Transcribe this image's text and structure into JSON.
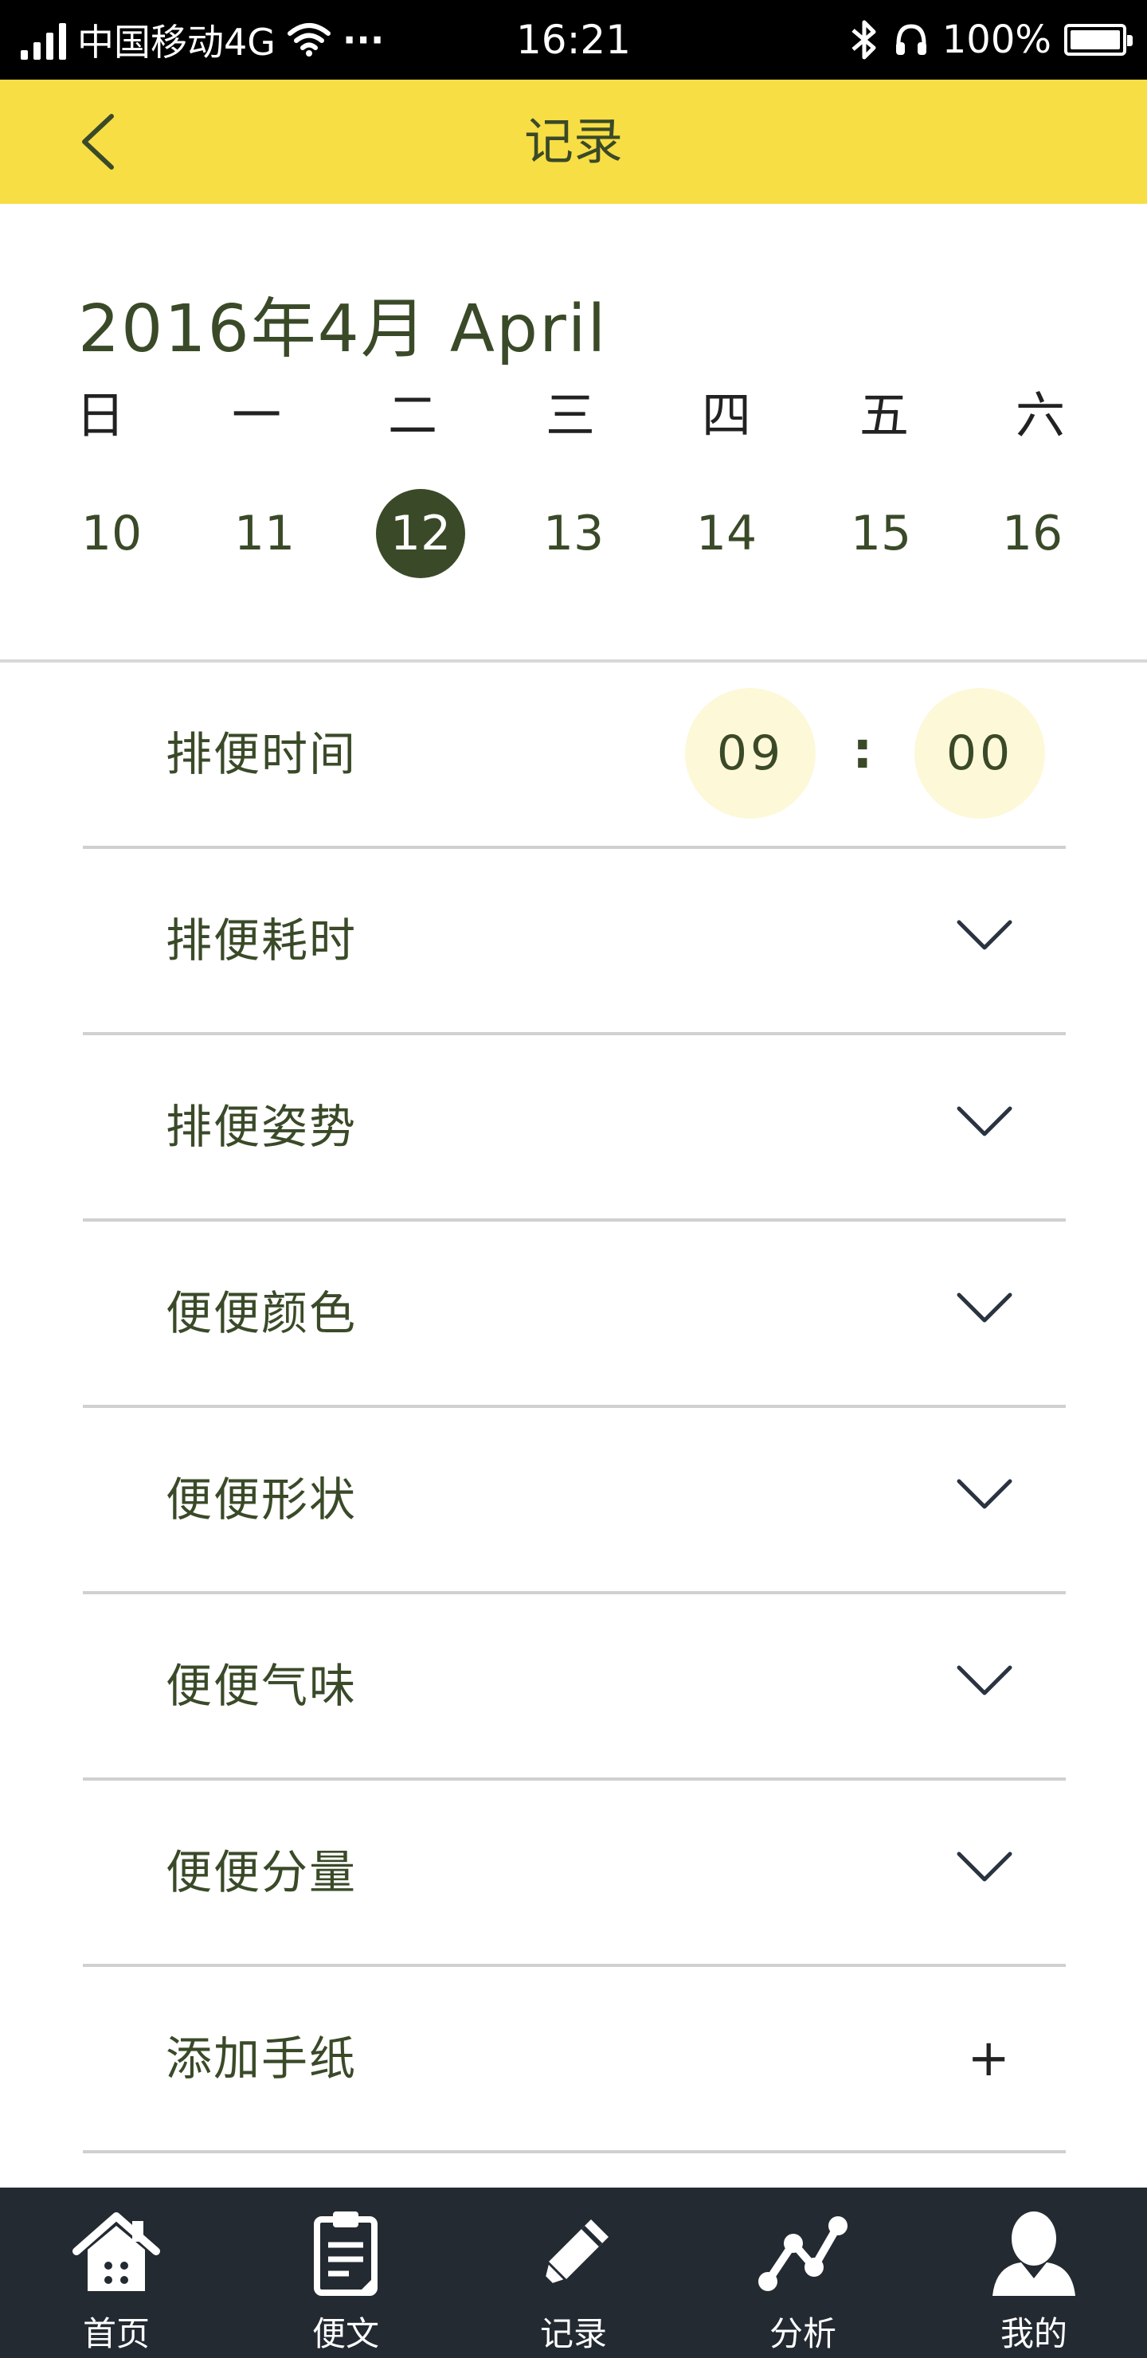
{
  "status_bar": {
    "carrier": "中国移动4G",
    "dots": "···",
    "time": "16:21",
    "battery": "100%"
  },
  "header": {
    "title": "记录"
  },
  "calendar": {
    "month_label": "2016年4月 April",
    "weekdays": [
      "日",
      "一",
      "二",
      "三",
      "四",
      "五",
      "六"
    ],
    "dates": [
      "10",
      "11",
      "12",
      "13",
      "14",
      "15",
      "16"
    ],
    "selected_date": "12"
  },
  "time_row": {
    "label": "排便时间",
    "hour": "09",
    "separator": ":",
    "minute": "00"
  },
  "rows": [
    {
      "label": "排便耗时",
      "control": "chevron-down-icon"
    },
    {
      "label": "排便姿势",
      "control": "chevron-down-icon"
    },
    {
      "label": "便便颜色",
      "control": "chevron-down-icon"
    },
    {
      "label": "便便形状",
      "control": "chevron-down-icon"
    },
    {
      "label": "便便气味",
      "control": "chevron-down-icon"
    },
    {
      "label": "便便分量",
      "control": "chevron-down-icon"
    },
    {
      "label": "添加手纸",
      "control": "plus-icon",
      "plus": "+"
    }
  ],
  "tabbar": {
    "items": [
      {
        "label": "首页",
        "icon": "home-icon"
      },
      {
        "label": "便文",
        "icon": "clipboard-icon"
      },
      {
        "label": "记录",
        "icon": "pencil-icon"
      },
      {
        "label": "分析",
        "icon": "chart-line-icon"
      },
      {
        "label": "我的",
        "icon": "user-icon"
      }
    ]
  },
  "colors": {
    "header_bg": "#f8de45",
    "text_dark_green": "#3a4a28",
    "time_bubble_bg": "#fdf8d8",
    "tabbar_bg": "#232a32"
  }
}
